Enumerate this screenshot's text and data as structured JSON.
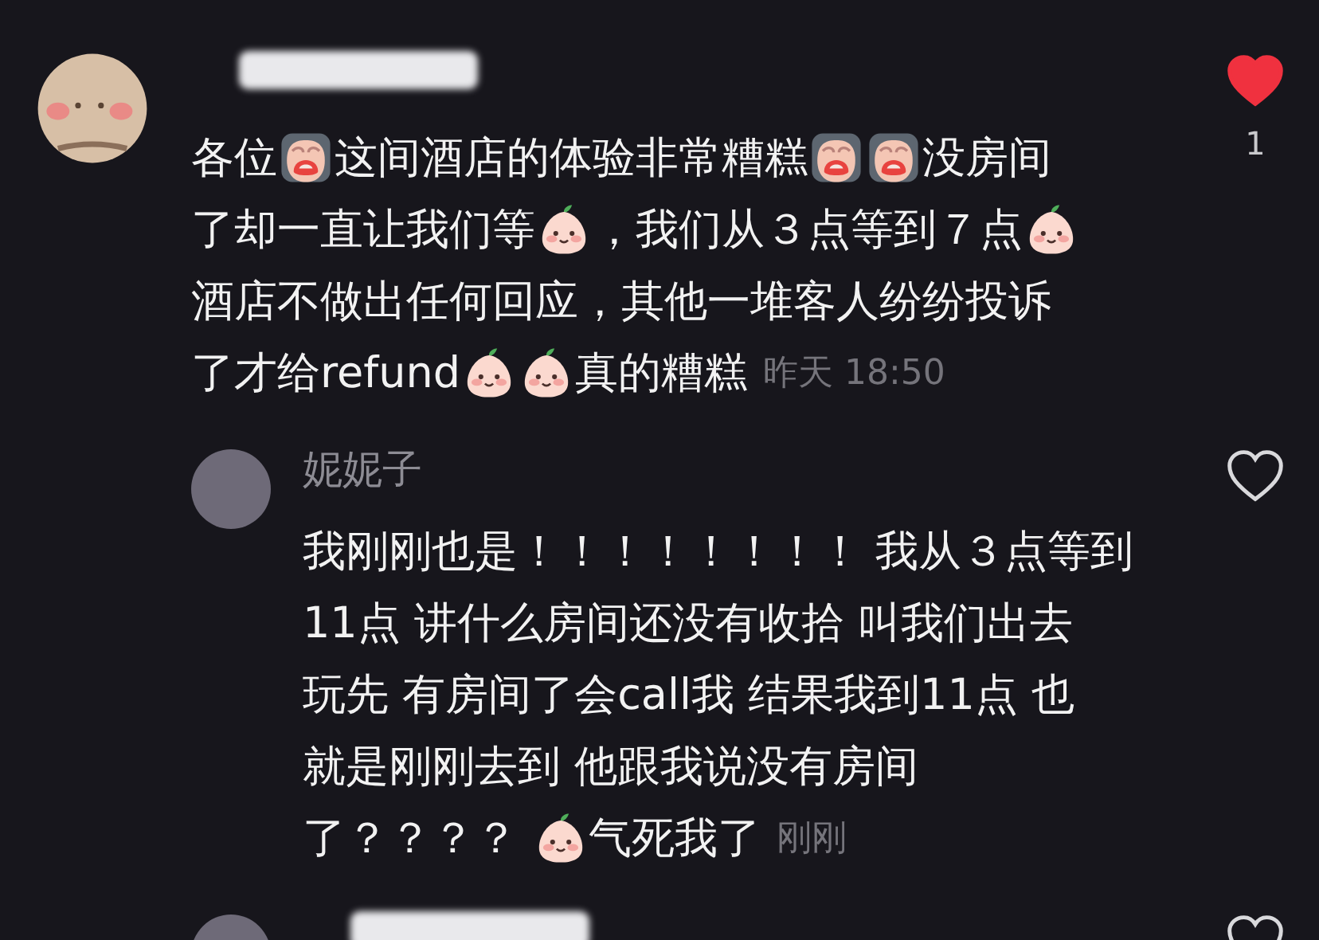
{
  "comments": [
    {
      "kind": "comment",
      "avatar": {
        "kind": "cartoon"
      },
      "name_hidden": true,
      "liked": true,
      "like_count": "1",
      "time": "昨天 18:50",
      "lines": [
        [
          {
            "kind": "text",
            "text": "各位"
          },
          {
            "kind": "cry"
          },
          {
            "kind": "text",
            "text": "这间酒店的体验非常糟糕"
          },
          {
            "kind": "cry"
          },
          {
            "kind": "cry"
          },
          {
            "kind": "text",
            "text": "没房间"
          }
        ],
        [
          {
            "kind": "text",
            "text": "了却一直让我们等"
          },
          {
            "kind": "peach"
          },
          {
            "kind": "text",
            "text": "，我们从３点等到７点"
          },
          {
            "kind": "peach"
          }
        ],
        [
          {
            "kind": "text",
            "text": "酒店不做出任何回应，其他一堆客人纷纷投诉"
          }
        ],
        [
          {
            "kind": "text",
            "text": "了才给refund"
          },
          {
            "kind": "peach"
          },
          {
            "kind": "peach"
          },
          {
            "kind": "text",
            "text": "真的糟糕"
          }
        ]
      ]
    },
    {
      "kind": "reply",
      "avatar": {
        "kind": "photo"
      },
      "name": "妮妮子",
      "liked": false,
      "time": "刚刚",
      "lines": [
        [
          {
            "kind": "text",
            "text": "我刚刚也是！！！！！！！！ 我从３点等到"
          }
        ],
        [
          {
            "kind": "text",
            "text": "11点 讲什么房间还没有收拾 叫我们出去"
          }
        ],
        [
          {
            "kind": "text",
            "text": "玩先 有房间了会call我 结果我到11点 也"
          }
        ],
        [
          {
            "kind": "text",
            "text": "就是刚刚去到 他跟我说没有房间"
          }
        ],
        [
          {
            "kind": "text",
            "text": "了？？？？ "
          },
          {
            "kind": "peach"
          },
          {
            "kind": "text",
            "text": "气死我了"
          }
        ]
      ]
    },
    {
      "kind": "reply",
      "avatar": {
        "kind": "photo"
      },
      "name_hidden": true,
      "liked": false
    }
  ]
}
